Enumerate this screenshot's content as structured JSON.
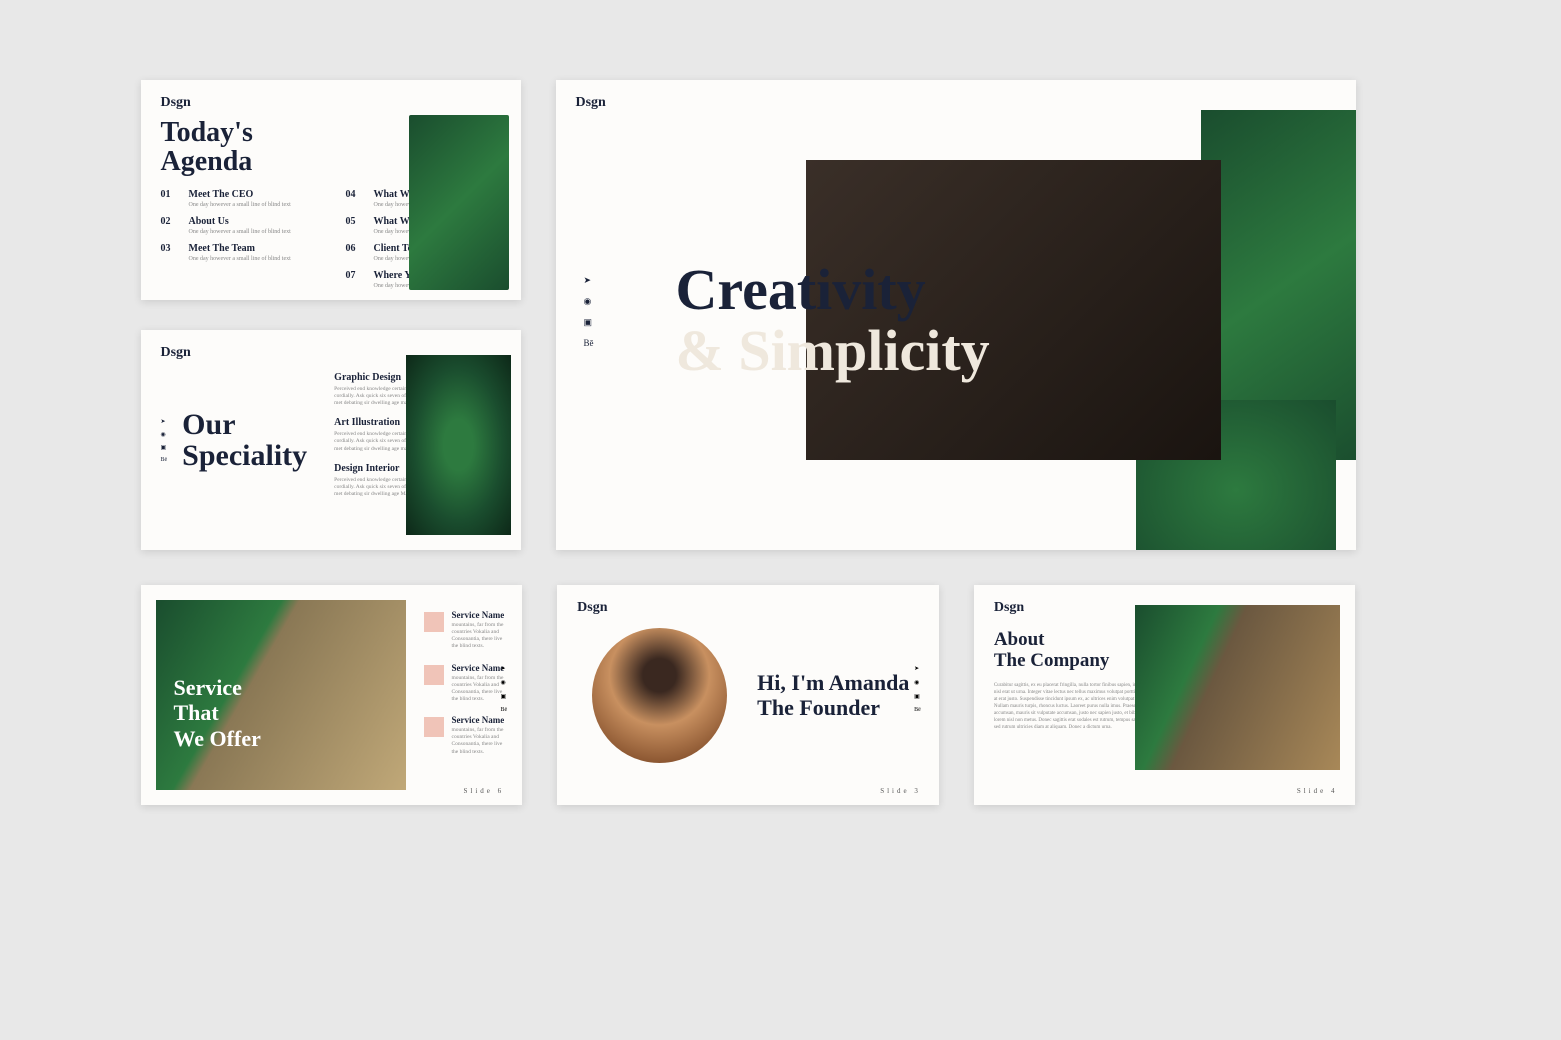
{
  "brand": "Dsgn",
  "agenda": {
    "title_l1": "Today's",
    "title_l2": "Agenda",
    "items": [
      {
        "num": "01",
        "title": "Meet The CEO",
        "sub": "One day however a small line of blind text"
      },
      {
        "num": "02",
        "title": "About Us",
        "sub": "One day however a small line of blind text"
      },
      {
        "num": "03",
        "title": "Meet The Team",
        "sub": "One day however a small line of blind text"
      },
      {
        "num": "04",
        "title": "What We Offer",
        "sub": "One day however a small line of blind text"
      },
      {
        "num": "05",
        "title": "What We've Done",
        "sub": "One day however a small line of blind text"
      },
      {
        "num": "06",
        "title": "Client Testimoni",
        "sub": "One day however a small line of blind text"
      },
      {
        "num": "07",
        "title": "Where You can Find Us",
        "sub": "One day however a small line of blind text"
      }
    ]
  },
  "speciality": {
    "title_l1": "Our",
    "title_l2": "Speciality",
    "items": [
      {
        "title": "Graphic Design",
        "sub": "Perceived end knowledge certainly day sweetness why cordially. Ask quick six seven offer see among. Handsome met debating sir dwelling age material."
      },
      {
        "title": "Art Illustration",
        "sub": "Perceived end knowledge certainly day sweetness why cordially. Ask quick six seven offer see among. Handsome met debating sir dwelling age material."
      },
      {
        "title": "Design Interior",
        "sub": "Perceived end knowledge certainly day sweetness why cordially. Ask quick six seven offer see among. Handsome met debating sir dwelling age Material."
      }
    ]
  },
  "hero": {
    "line1": "Creativity",
    "line2": "& Simplicity"
  },
  "service": {
    "title_l1": "Service",
    "title_l2": "That",
    "title_l3": "We Offer",
    "items": [
      {
        "title": "Service Name",
        "sub": "mountains, far from the countries Vokalia and Consonantia, there live the blind texts."
      },
      {
        "title": "Service Name",
        "sub": "mountains, far from the countries Vokalia and Consonantia, there live the blind texts."
      },
      {
        "title": "Service Name",
        "sub": "mountains, far from the countries Vokalia and Consonantia, there live the blind texts."
      }
    ],
    "slide_num": "Slide 6"
  },
  "founder": {
    "line1": "Hi, I'm Amanda",
    "line2": "The Founder",
    "slide_num": "Slide 3"
  },
  "about": {
    "title_l1": "About",
    "title_l2": "The Company",
    "text": "Curabitur sagittis, ex eu placerat fringilla, nulla tortor finibus sapien, in sodales nisl erat ut urna. Integer vitae lectus nec tellus maximus volutpat porttitor quis at erat justo. Suspendisse tincidunt ipsum ex, ac ultrices enim volutpat ac. Nullam mauris turpis, rhoncus luctus. Laoreet purus nulla imus. Praesent accumsan, mauris sit vulputate accumsan, justo nec sapien justo, et bibendum lorem nisl non metus. Donec sagittis erat sodales est rutrum, tempus sagittis, sed rutrum ultricies diam at aliquam. Donec a dictum urna.",
    "slide_num": "Slide 4"
  },
  "icons": {
    "twitter": "➤",
    "instagram": "◉",
    "youtube": "▣",
    "behance": "Bē"
  }
}
